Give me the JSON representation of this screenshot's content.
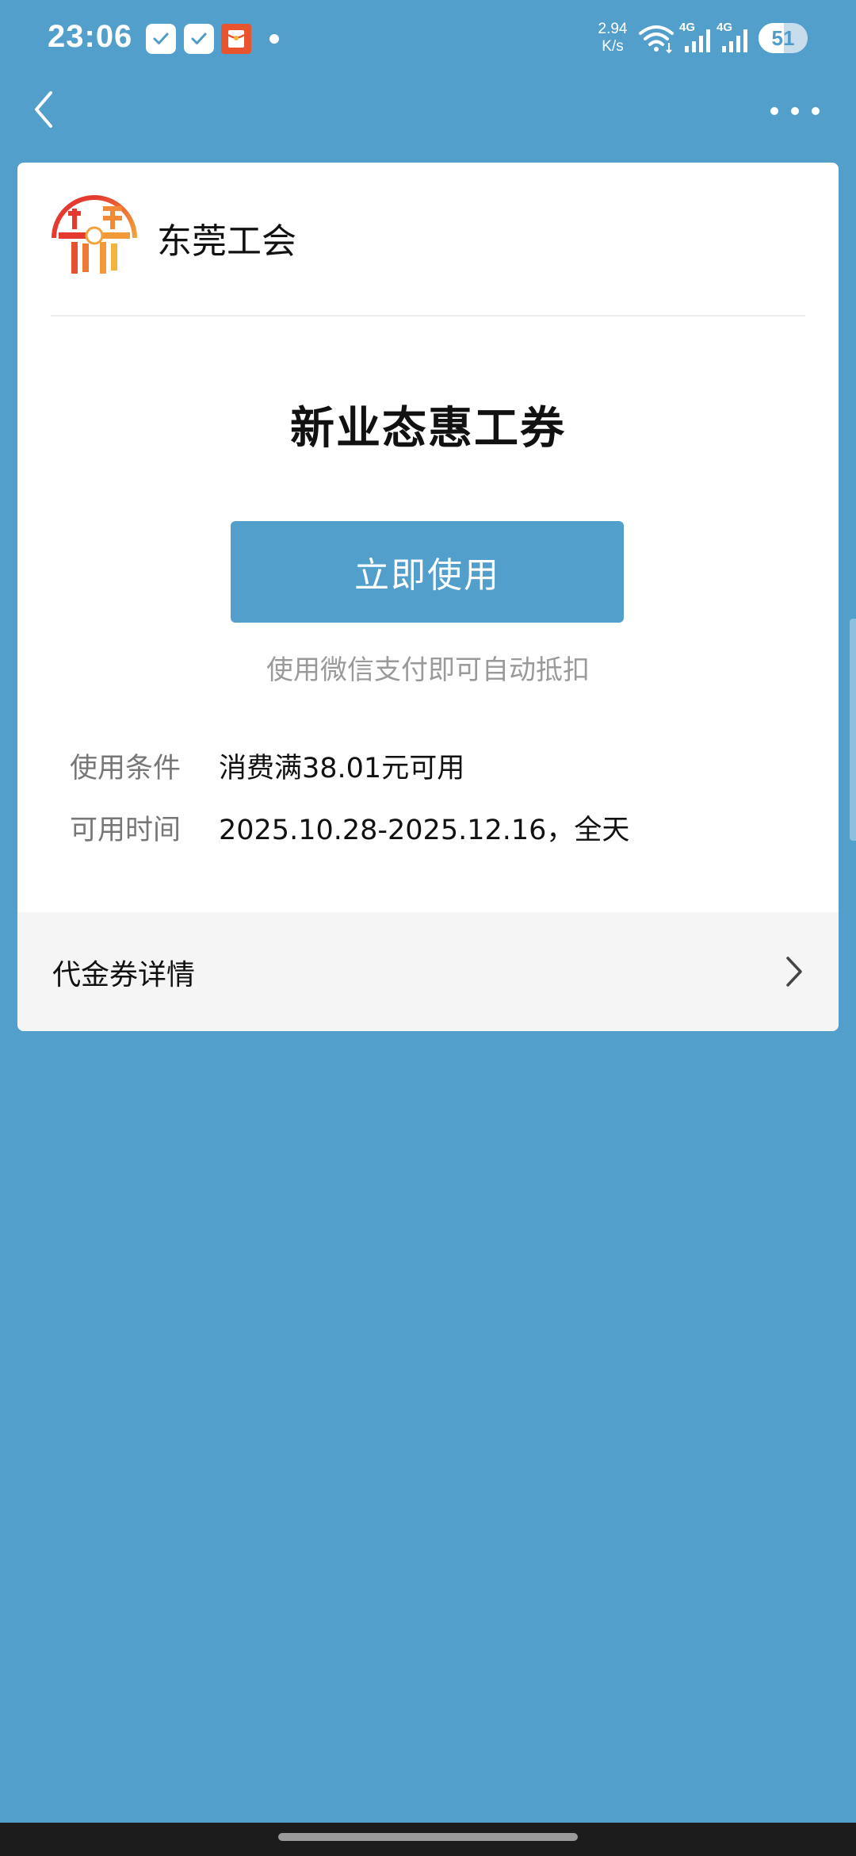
{
  "status_bar": {
    "time": "23:06",
    "net_speed_value": "2.94",
    "net_speed_unit": "K/s",
    "signal_1_label": "4G",
    "signal_2_label": "4G",
    "battery_level": "51",
    "battery_fraction": 0.51,
    "notification_icons": [
      "check-badge-icon",
      "check-badge-icon",
      "red-envelope-icon"
    ]
  },
  "nav": {
    "back_icon": "chevron-left-icon",
    "more_icon": "more-dots-icon"
  },
  "merchant": {
    "name": "东莞工会",
    "logo_icon": "union-seal-logo"
  },
  "coupon": {
    "title": "新业态惠工券",
    "use_button_label": "立即使用",
    "hint": "使用微信支付即可自动抵扣"
  },
  "info": {
    "condition_label": "使用条件",
    "condition_value": "消费满38.01元可用",
    "time_label": "可用时间",
    "time_value": "2025.10.28-2025.12.16，全天"
  },
  "details": {
    "label": "代金券详情",
    "chevron_icon": "chevron-right-icon"
  },
  "colors": {
    "background": "#529fcb",
    "button": "#529fcb",
    "card": "#ffffff",
    "details_bg": "#f5f5f5"
  }
}
